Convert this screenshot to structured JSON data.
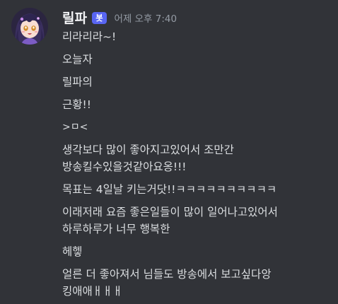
{
  "message": {
    "username": "릴파",
    "bot_tag": "봇",
    "timestamp": "어제 오후 7:40",
    "avatar_icon": "anime-girl-avatar",
    "lines": [
      "리라리라~!",
      "오늘자",
      "릴파의",
      "근황!!",
      ">ㅁ<",
      "생각보다 많이 좋아지고있어서 조만간",
      "방송킬수있을것같아요옹!!!",
      "목표는 4일날 키는거닷!!ㅋㅋㅋㅋㅋㅋㅋㅋㅋㅋ",
      "이래저래 요즘 좋은일들이 많이 일어나고있어서",
      "하루하루가 너무 행복한",
      "헤헿",
      "얼른 더 좋아져서 님들도 방송에서 보고싶다앙",
      "킹애애ㅐㅐㅐ"
    ]
  },
  "colors": {
    "background": "#313338",
    "text": "#dbdee1",
    "username": "#f2f3f5",
    "timestamp": "#949ba4",
    "bot_tag": "#5865f2"
  }
}
